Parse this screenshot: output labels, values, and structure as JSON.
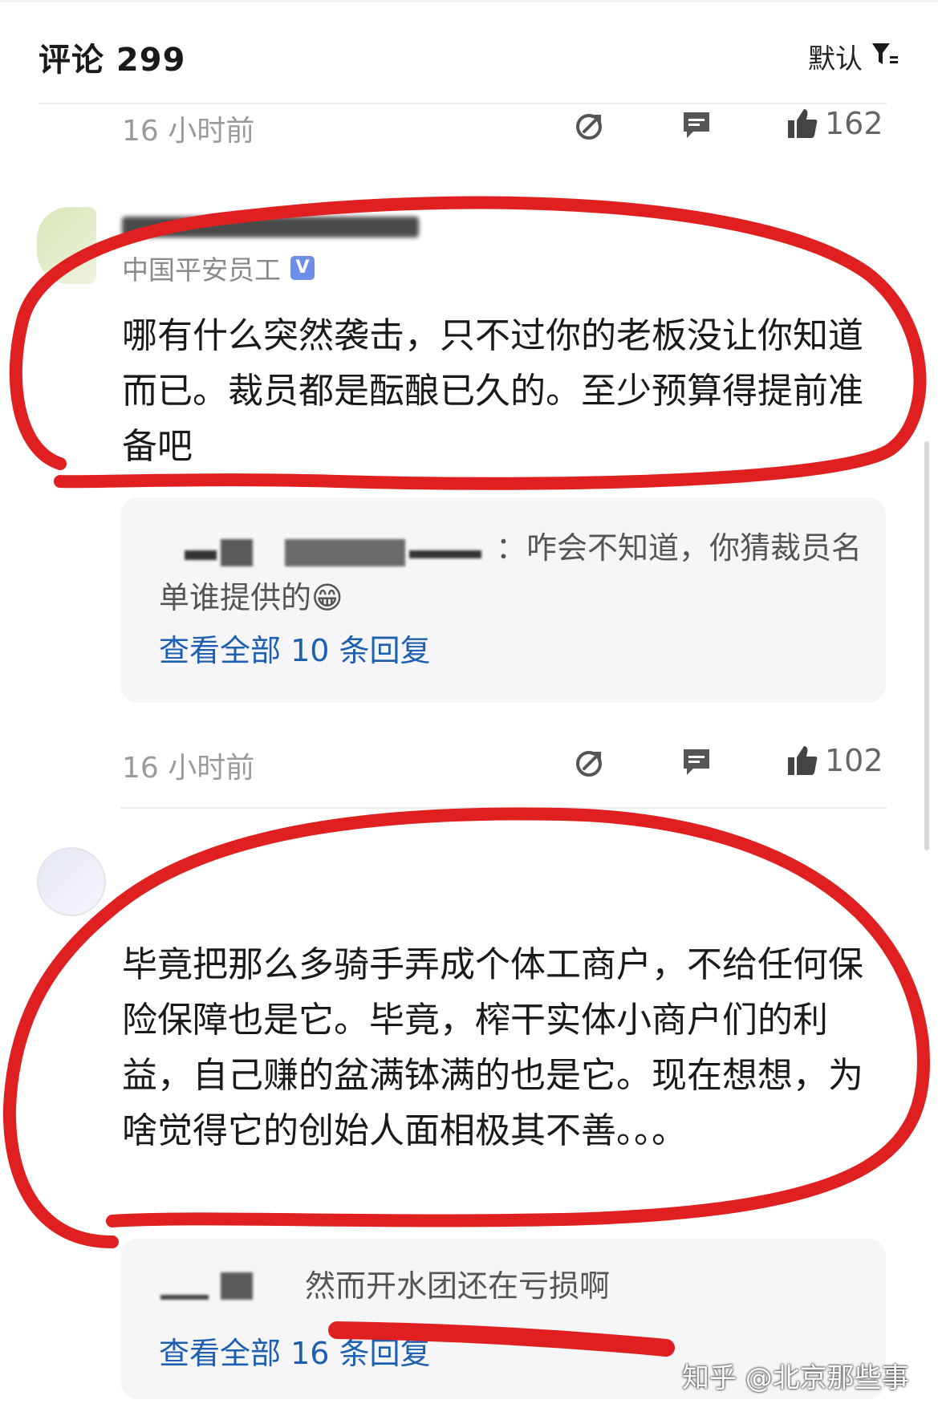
{
  "header": {
    "title": "评论 299",
    "sort_label": "默认"
  },
  "comments": [
    {
      "time": "16 小时前",
      "likes": "162"
    },
    {
      "author_badge": "中国平安员工",
      "verify_mark": "V",
      "content": "哪有什么突然袭击，只不过你的老板没让你知道而已。裁员都是酝酿已久的。至少预算得提前准备吧",
      "reply_preview": "：咋会不知道，你猜裁员名单谁提供的",
      "reply_emoji": "😁",
      "view_replies": "查看全部 10 条回复",
      "time": "16 小时前",
      "likes": "102"
    },
    {
      "content": "毕竟把那么多骑手弄成个体工商户，不给任何保险保障也是它。毕竟，榨干实体小商户们的利益，自己赚的盆满钵满的也是它。现在想想，为啥觉得它的创始人面相极其不善。。。",
      "reply_preview": "然而开水团还在亏损啊",
      "view_replies": "查看全部 16 条回复"
    }
  ],
  "watermark": "知乎 @北京那些事"
}
